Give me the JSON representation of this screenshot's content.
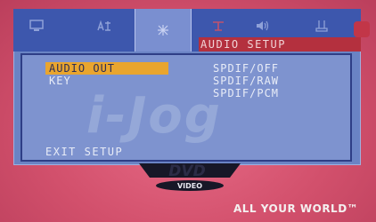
{
  "tabs": [
    {
      "icon": "monitor-icon",
      "active": false
    },
    {
      "icon": "language-icon",
      "active": false
    },
    {
      "icon": "audio-settings-icon",
      "active": true
    },
    {
      "icon": "video-antenna-icon",
      "active": false
    },
    {
      "icon": "speaker-icon",
      "active": false
    },
    {
      "icon": "preference-icon",
      "active": false
    }
  ],
  "header": {
    "title": "AUDIO SETUP"
  },
  "menu": {
    "items": [
      {
        "label": "AUDIO OUT",
        "selected": true
      },
      {
        "label": "KEY",
        "selected": false
      }
    ],
    "exit_label": "EXIT SETUP"
  },
  "options": [
    "SPDIF/OFF",
    "SPDIF/RAW",
    "SPDIF/PCM"
  ],
  "watermark": "i-Jog",
  "logo": {
    "dvd_text": "DVD",
    "video_text": "VIDEO"
  },
  "slogan": "ALL YOUR WORLD™",
  "colors": {
    "tv_background": "#d9536f",
    "osd_panel": "#6a83c4",
    "tab_bar": "#3d57ad",
    "title_bar": "#b4303e",
    "highlight": "#e9a52e"
  }
}
